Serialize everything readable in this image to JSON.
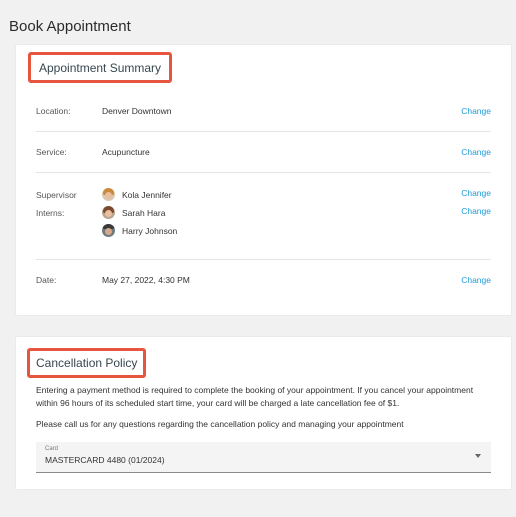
{
  "page": {
    "title": "Book Appointment"
  },
  "summary": {
    "title": "Appointment Summary",
    "location_label": "Location:",
    "location_value": "Denver Downtown",
    "service_label": "Service:",
    "service_value": "Acupuncture",
    "supervisor_label": "Supervisor",
    "interns_label": "Interns:",
    "people": [
      {
        "name": "Kola Jennifer",
        "icon": "avatar-female"
      },
      {
        "name": "Sarah Hara",
        "icon": "avatar-female"
      },
      {
        "name": "Harry Johnson",
        "icon": "avatar-male"
      }
    ],
    "date_label": "Date:",
    "date_value": "May 27, 2022, 4:30 PM",
    "change_label": "Change"
  },
  "policy": {
    "title": "Cancellation Policy",
    "text": "Entering a payment method is required to complete the booking of your appointment. If you cancel your appointment within 96 hours of its scheduled start time, your card will be charged a late cancellation fee of $1.",
    "text2": "Please call us for any questions regarding the cancellation policy and managing your appointment",
    "card_label": "Card",
    "card_value": "MASTERCARD 4480 (01/2024)"
  },
  "colors": {
    "accent": "#1e9bd7",
    "highlight_border": "#e8553e",
    "background": "#f1f1f1"
  }
}
